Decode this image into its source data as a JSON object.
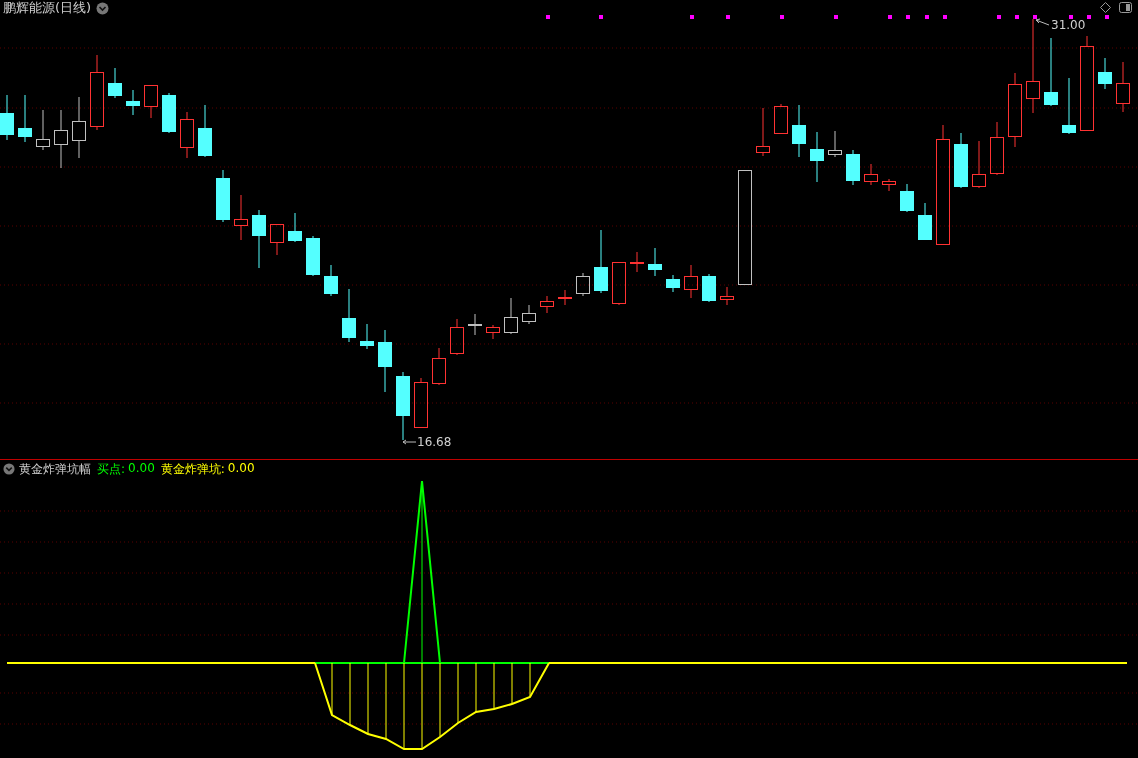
{
  "main_chart": {
    "title": "鹏辉能源(日线)",
    "high_label": "31.00",
    "low_label": "16.68"
  },
  "indicator": {
    "name": "黄金炸弹坑幅",
    "outputs": [
      {
        "kind": "buy",
        "label": "买点:",
        "value": "0.00"
      },
      {
        "kind": "pit",
        "label": "黄金炸弹坑:",
        "value": "0.00"
      }
    ]
  }
}
